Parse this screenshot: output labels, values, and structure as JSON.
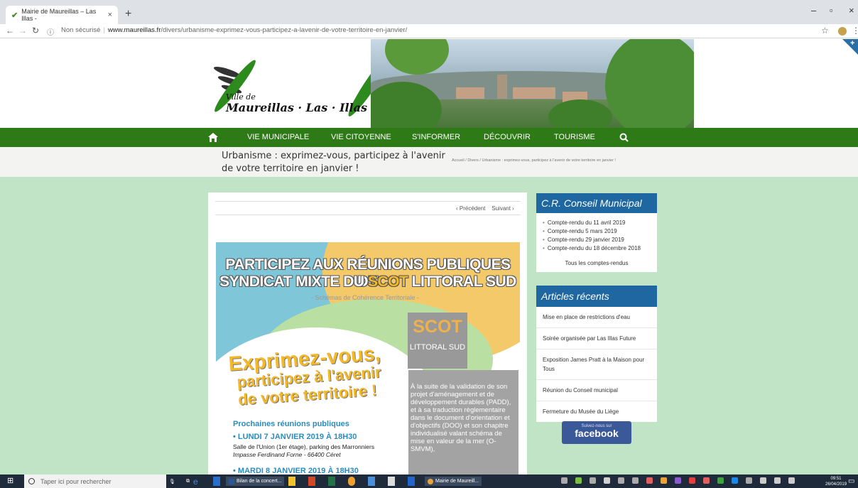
{
  "browser": {
    "tab_title": "Mairie de Maureillas – Las Illas - ",
    "tab_close": "×",
    "new_tab": "+",
    "security": "Non sécurisé",
    "url_domain": "www.maureillas.fr",
    "url_path": "/divers/urbanisme-exprimez-vous-participez-a-lavenir-de-votre-territoire-en-janvier/"
  },
  "header": {
    "logo_line1": "Ville de",
    "logo_line2": "Maureillas · Las · Illas"
  },
  "nav": {
    "items": [
      "VIE MUNICIPALE",
      "VIE CITOYENNE",
      "S'INFORMER",
      "DÉCOUVRIR",
      "TOURISME"
    ]
  },
  "page": {
    "title": "Urbanisme : exprimez-vous, participez à l'avenir de votre territoire en janvier !",
    "breadcrumb": "Accueil / Divers / Urbanisme : exprimez-vous, participez à l'avenir de votre territoire en janvier !",
    "prev": "‹ Précédent",
    "next": "Suivant ›"
  },
  "poster": {
    "headline1": "PARTICIPEZ AUX RÉUNIONS PUBLIQUES DU",
    "headline2a": "SYNDICAT MIXTE DU ",
    "headline2b": "SCOT",
    "headline2c": " LITTORAL SUD",
    "subtitle": "- Schémas de Cohérence Territoriale -",
    "scot": "SCOT",
    "littoral": "LITTORAL SUD",
    "express1": "Exprimez-vous,",
    "express2": "participez à l'avenir",
    "express3": "de votre territoire !",
    "gray_text": "À la suite de la validation de son projet d'aménagement et de développement durables (PADD), et à sa traduction règlementaire dans le document d'orientation et d'objectifs (DOO) et son chapitre individualisé valant schéma de mise en valeur de la mer (O-SMVM),",
    "prochaines": "Prochaines réunions publiques",
    "date1": "• LUNDI 7 JANVIER 2019 À 18H30",
    "date1_place": "Salle de l'Union (1er étage), parking des Marronniers",
    "date1_addr": "Impasse Ferdinand Forne - 66400 Céret",
    "date2": "• MARDI 8 JANVIER 2019 À 18H30"
  },
  "sidebar": {
    "cr_title": "C.R. Conseil Municipal",
    "cr_items": [
      "Compte-rendu du 11 avril 2019",
      "Compte-rendu 5 mars 2019",
      "Compte-rendu 29 janvier 2019",
      "Compte-rendu du 18 décembre 2018"
    ],
    "cr_all": "Tous les comptes-rendus",
    "articles_title": "Articles récents",
    "articles": [
      "Mise en place de restrictions d'eau",
      "Soirée organisée par Las Illas Future",
      "Exposition James Pratt à la Maison pour Tous",
      "Réunion du Conseil municipal",
      "Fermeture du Musée du Liège"
    ],
    "fb_small": "Suivez-nous sur",
    "fb_big": "facebook"
  },
  "taskbar": {
    "search": "Taper ici pour rechercher",
    "word_item": "Bilan de la concert...",
    "chrome_item": "Mairie de Maureill...",
    "time": "09:51",
    "date": "26/04/2019"
  }
}
